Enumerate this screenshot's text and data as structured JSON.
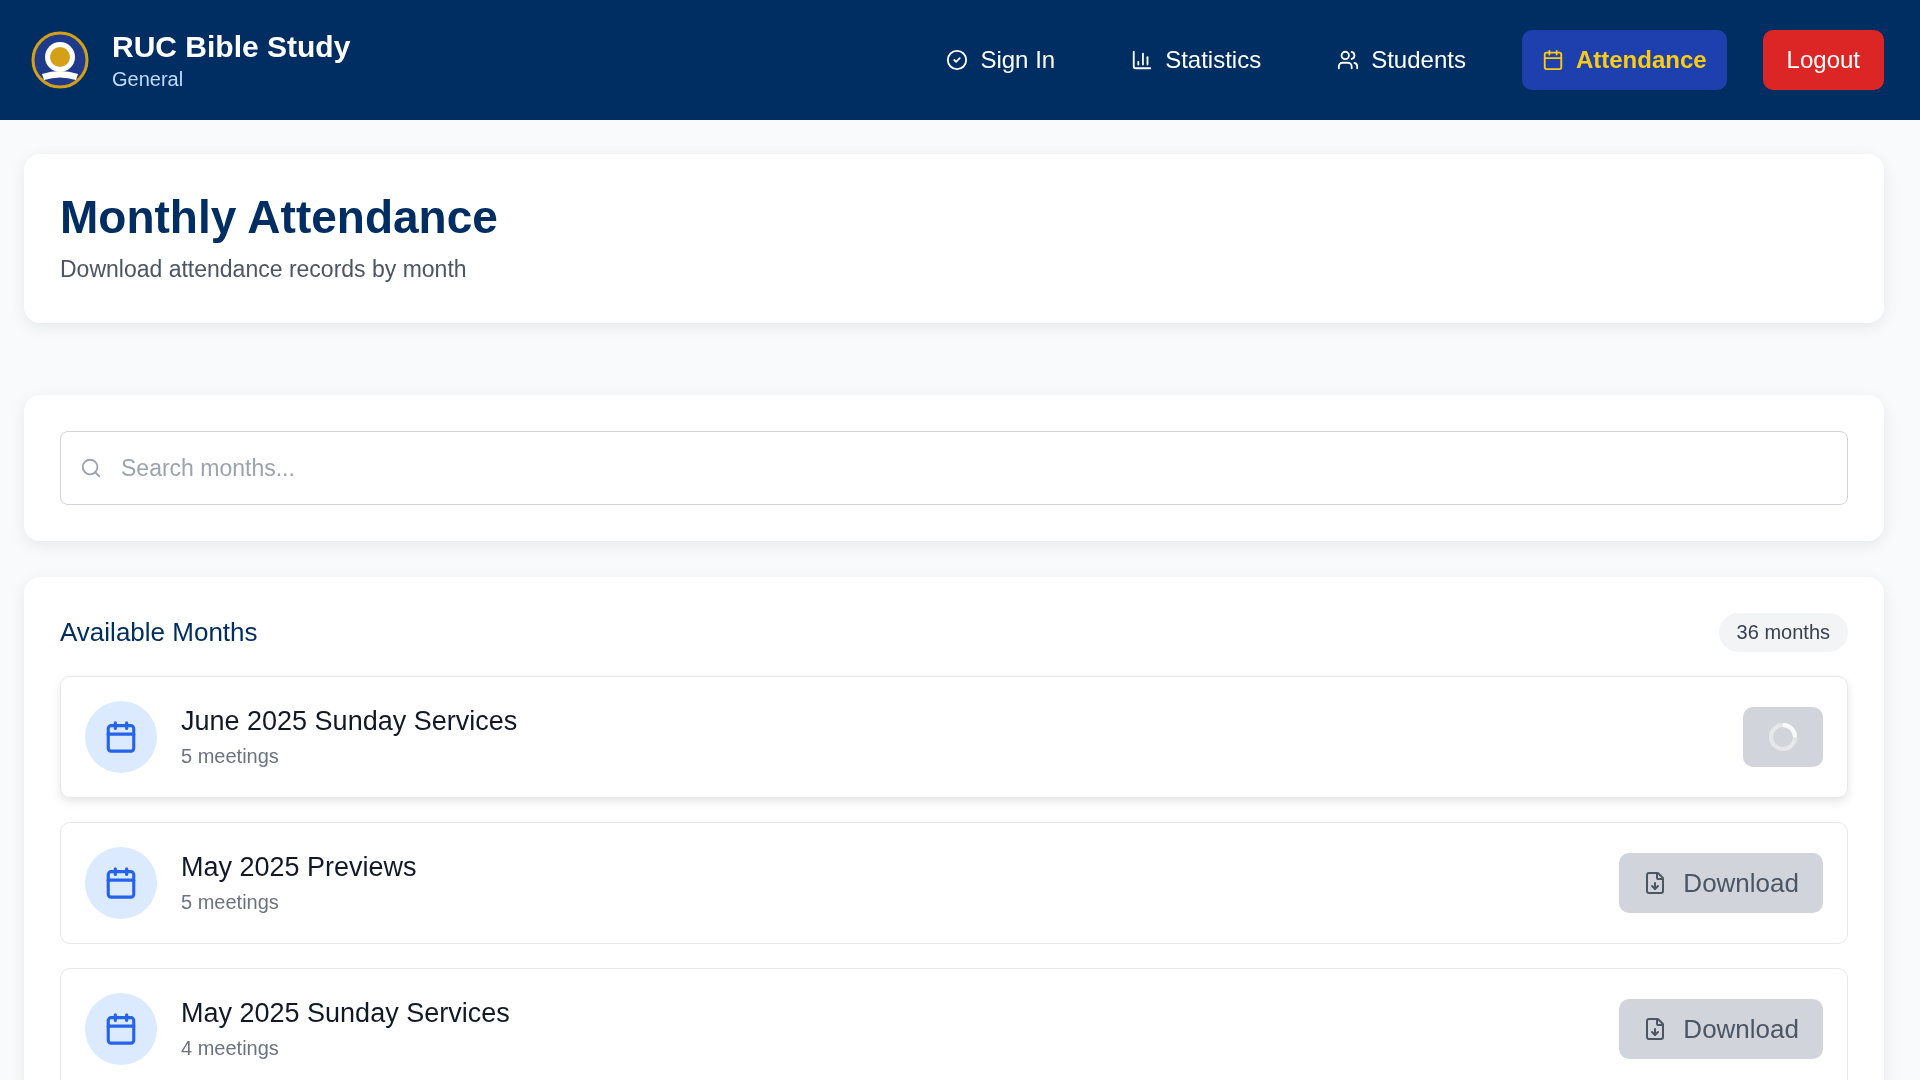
{
  "brand": {
    "title": "RUC Bible Study",
    "subtitle": "General"
  },
  "nav": [
    {
      "label": "Sign In",
      "selected": false
    },
    {
      "label": "Statistics",
      "selected": false
    },
    {
      "label": "Students",
      "selected": false
    },
    {
      "label": "Attendance",
      "selected": true
    }
  ],
  "logout": "Logout",
  "page": {
    "title": "Monthly Attendance",
    "subtitle": "Download attendance records by month"
  },
  "search": {
    "placeholder": "Search months..."
  },
  "months_section": {
    "title": "Available Months",
    "count": "36 months"
  },
  "months": [
    {
      "title": "June 2025 Sunday Services",
      "meetings": "5 meetings",
      "loading": true
    },
    {
      "title": "May 2025 Previews",
      "meetings": "5 meetings",
      "loading": false,
      "button": "Download"
    },
    {
      "title": "May 2025 Sunday Services",
      "meetings": "4 meetings",
      "loading": false,
      "button": "Download"
    }
  ]
}
